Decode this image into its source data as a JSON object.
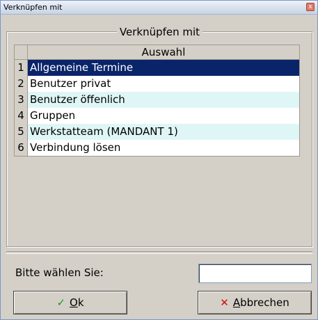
{
  "window": {
    "title": "Verknüpfen mit",
    "close_glyph": "x"
  },
  "group": {
    "legend": "Verknüpfen mit"
  },
  "grid": {
    "header": "Auswahl",
    "rows": [
      {
        "num": "1",
        "label": "Allgemeine Termine"
      },
      {
        "num": "2",
        "label": "Benutzer privat"
      },
      {
        "num": "3",
        "label": "Benutzer öffenlich"
      },
      {
        "num": "4",
        "label": "Gruppen"
      },
      {
        "num": "5",
        "label": "Werkstatteam (MANDANT 1)"
      },
      {
        "num": "6",
        "label": "Verbindung lösen"
      }
    ]
  },
  "prompt": {
    "label": "Bitte wählen Sie:",
    "value": ""
  },
  "buttons": {
    "ok": {
      "icon": "✓",
      "accel": "O",
      "rest": "k"
    },
    "cancel": {
      "icon": "✕",
      "accel": "A",
      "rest": "bbrechen"
    }
  },
  "colors": {
    "selection": "#0a246a",
    "row_alt": "#dff6f6",
    "ok_icon": "#1a9a1a",
    "cancel_icon": "#d01010"
  }
}
